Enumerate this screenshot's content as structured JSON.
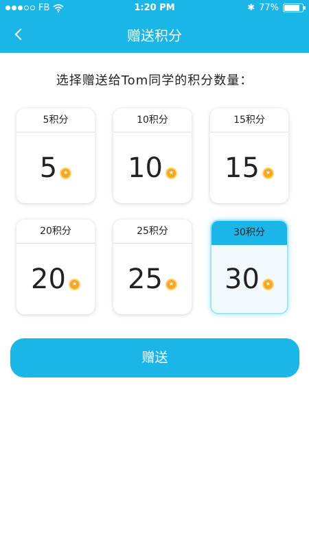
{
  "status_bar": {
    "carrier": "FB",
    "time": "1:20 PM",
    "battery": "77%",
    "battery_level": 0.77,
    "signal_bars_filled": 3,
    "signal_bars_total": 5
  },
  "header": {
    "title": "赠送积分",
    "back_icon": "chevron-left-icon",
    "background_color": "#1ab6e8"
  },
  "prompt": "选择赠送给Tom同学的积分数量：",
  "options": [
    {
      "label": "5积分",
      "value": "5",
      "selected": false
    },
    {
      "label": "10积分",
      "value": "10",
      "selected": false
    },
    {
      "label": "15积分",
      "value": "15",
      "selected": false
    },
    {
      "label": "20积分",
      "value": "20",
      "selected": false
    },
    {
      "label": "25积分",
      "value": "25",
      "selected": false
    },
    {
      "label": "30积分",
      "value": "30",
      "selected": true
    }
  ],
  "coin_icon": "coin-star-icon",
  "submit_label": "赠送",
  "accent_color": "#1ab6e8"
}
